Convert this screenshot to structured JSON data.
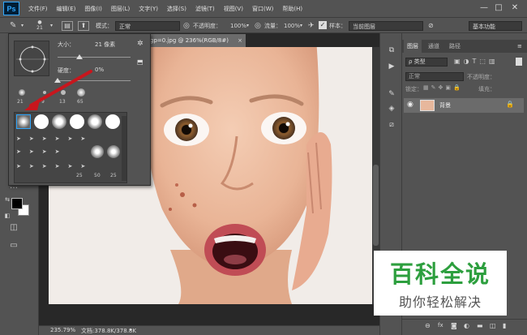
{
  "menubar": {
    "logo": "Ps",
    "items": [
      "文件(F)",
      "编辑(E)",
      "图像(I)",
      "图层(L)",
      "文字(Y)",
      "选择(S)",
      "滤镜(T)",
      "视图(V)",
      "窗口(W)",
      "帮助(H)"
    ],
    "minimize": "—",
    "maximize": "□",
    "close": "✕"
  },
  "options": {
    "brush_size": "21",
    "mode_label": "模式：",
    "mode_value": "正常",
    "opacity_label": "不透明度：",
    "opacity_value": "100%",
    "flow_label": "流量：",
    "flow_value": "100%",
    "sample_label": "样本：",
    "sample_value": "当前图层",
    "workspace": "基本功能"
  },
  "document": {
    "tab_title": "gp=0.jpg @ 236%(RGB/8#)",
    "close": "×"
  },
  "brush_popup": {
    "size_label": "大小：",
    "size_value": "21 像素",
    "hardness_label": "硬度：",
    "hardness_value": "0%",
    "size_fraction": 0.3,
    "hardness_fraction": 0.0,
    "recent_sizes": [
      "21",
      "9",
      "13",
      "65"
    ],
    "grid_labels": [
      "25",
      "50",
      "25"
    ]
  },
  "status": {
    "zoom": "235.79%",
    "doc_info": "文档:378.8K/378.8K"
  },
  "panel": {
    "tabs": [
      "图层",
      "通道",
      "路径"
    ],
    "kind_label": "ρ 类型",
    "blend_mode": "正常",
    "opacity_label": "不透明度：",
    "lock_label": "锁定：",
    "fill_label": "填充：",
    "layer_name": "背景",
    "footer_icons": [
      "link-icon",
      "fx-icon",
      "mask-icon",
      "adjust-icon",
      "folder-icon",
      "new-layer-icon",
      "trash-icon"
    ]
  },
  "watermark": {
    "title": "百科全说",
    "subtitle": "助你轻松解决"
  },
  "colors": {
    "accent": "#31a8ff",
    "arrow": "#c8161d",
    "watermark_green": "#2d9f3e"
  }
}
